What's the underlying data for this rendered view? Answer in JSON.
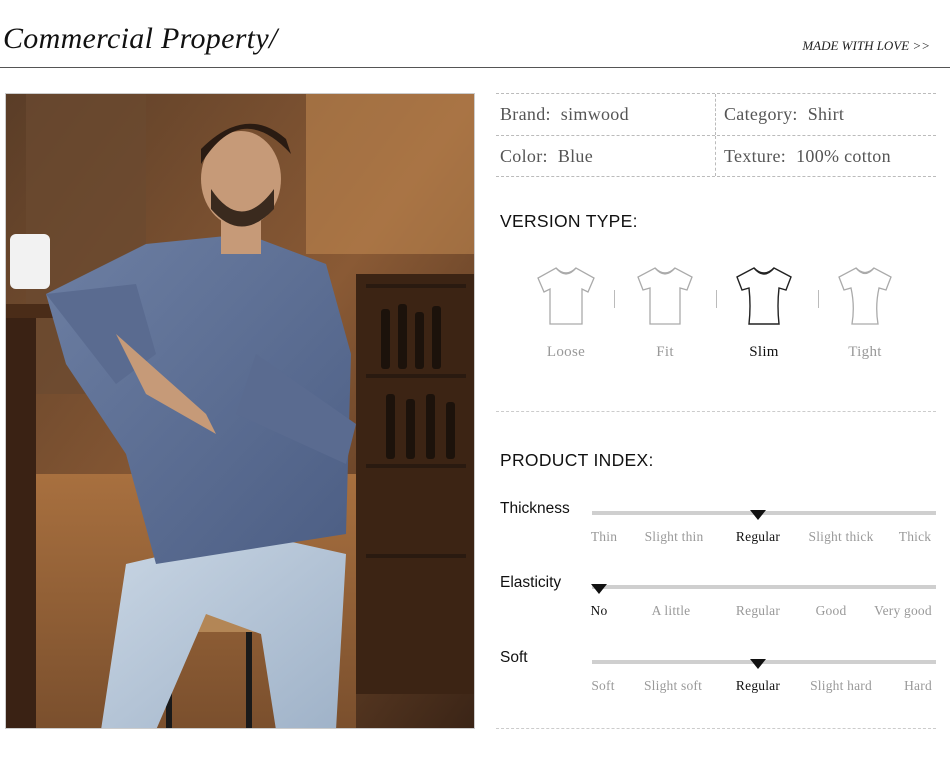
{
  "header": {
    "title": "Commercial Property/",
    "tagline": "MADE WITH LOVE >>"
  },
  "specs": {
    "brand_label": "Brand:",
    "brand_value": "simwood",
    "category_label": "Category:",
    "category_value": "Shirt",
    "color_label": "Color:",
    "color_value": "Blue",
    "texture_label": "Texture:",
    "texture_value": "100% cotton"
  },
  "version": {
    "title": "VERSION TYPE:",
    "items": [
      {
        "label": "Loose",
        "icon": "loose-tshirt-icon"
      },
      {
        "label": "Fit",
        "icon": "fit-tshirt-icon"
      },
      {
        "label": "Slim",
        "icon": "slim-tshirt-icon"
      },
      {
        "label": "Tight",
        "icon": "tight-tshirt-icon"
      }
    ],
    "selected": "Slim"
  },
  "index": {
    "title": "PRODUCT INDEX:",
    "scales": [
      {
        "name": "Thickness",
        "ticks": [
          "Thin",
          "Slight thin",
          "Regular",
          "Slight thick",
          "Thick"
        ],
        "selected": "Regular",
        "selected_index": 2
      },
      {
        "name": "Elasticity",
        "ticks": [
          "No",
          "A little",
          "Regular",
          "Good",
          "Very good"
        ],
        "selected": "No",
        "selected_index": 0
      },
      {
        "name": "Soft",
        "ticks": [
          "Soft",
          "Slight soft",
          "Regular",
          "Slight hard",
          "Hard"
        ],
        "selected": "Regular",
        "selected_index": 2
      }
    ]
  },
  "colors": {
    "accent": "#111111",
    "muted": "#999999",
    "bar": "#cfcfcf"
  }
}
